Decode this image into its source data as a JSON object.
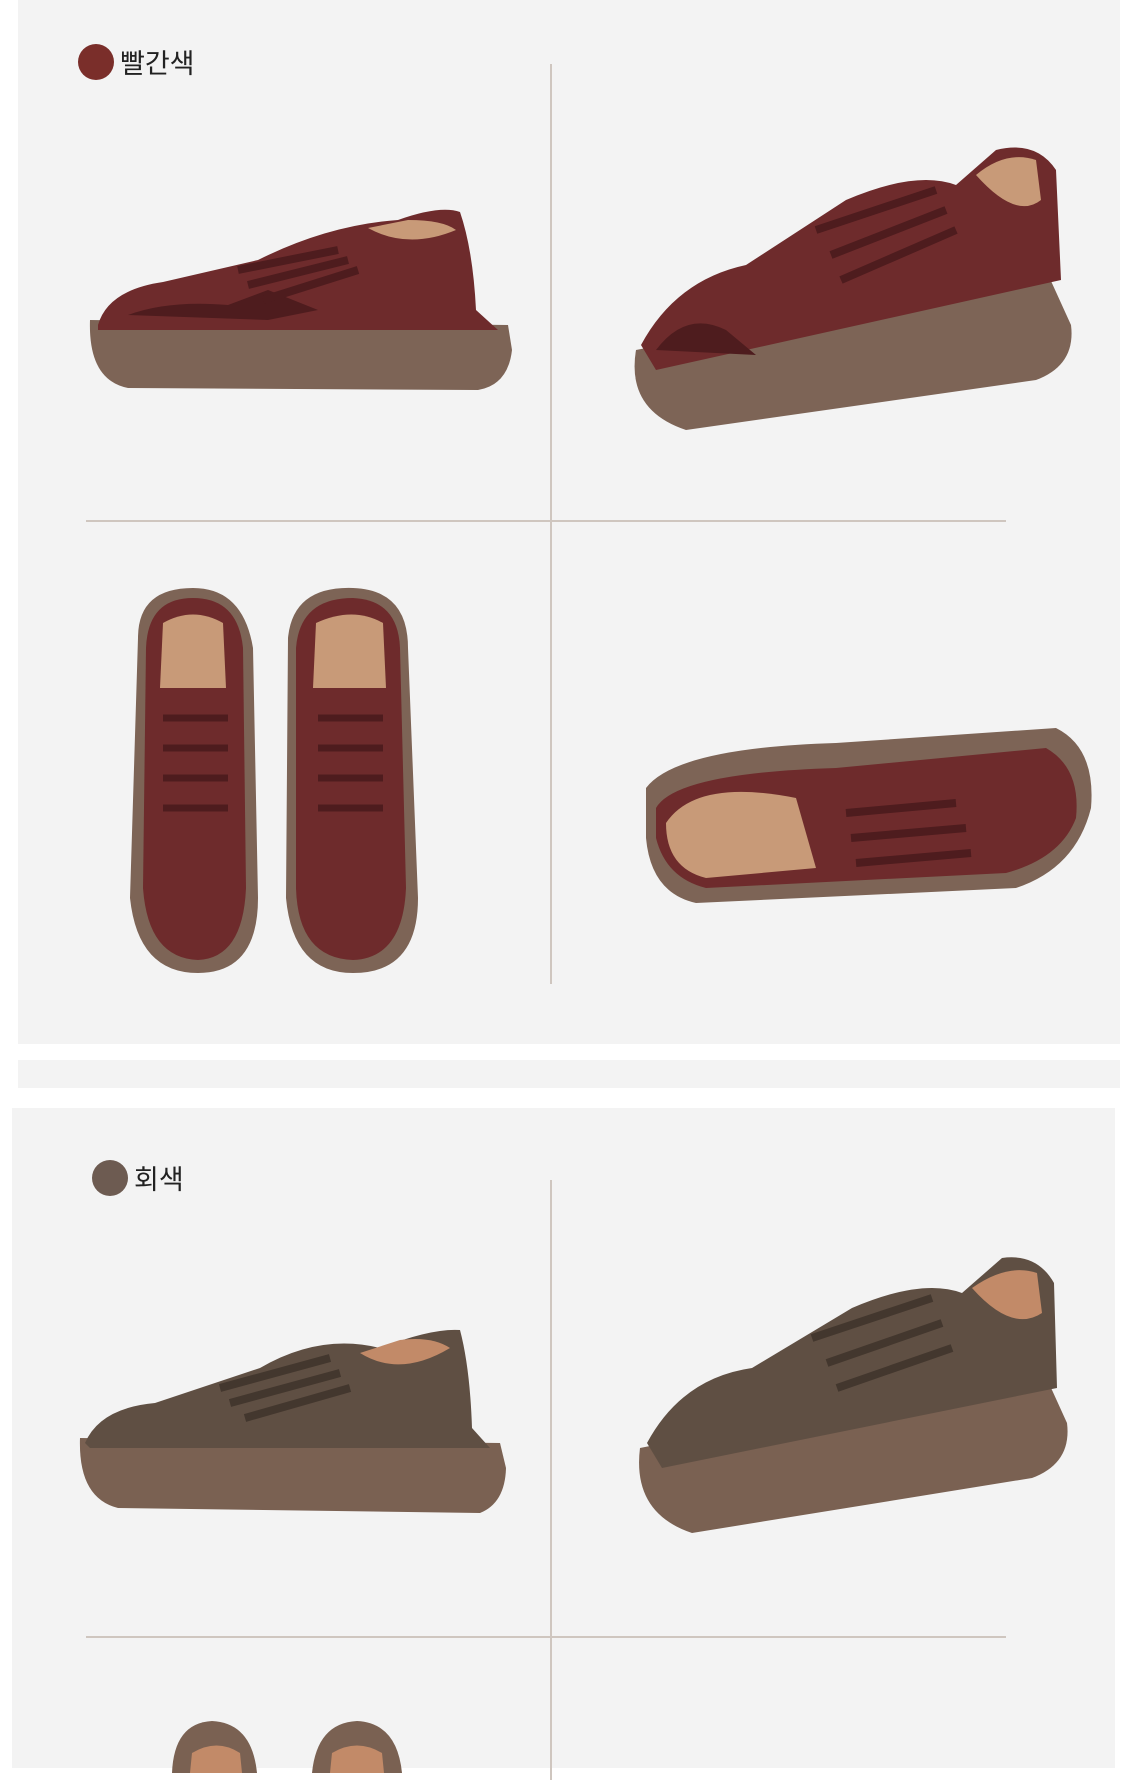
{
  "sections": [
    {
      "color_name": "빨간색",
      "swatch_color": "#7a2e2a",
      "upper_color": "#6e2b2c",
      "upper_dark": "#4e1c1e",
      "sole_color": "#7d6456",
      "lining_color": "#c89a78",
      "views": [
        "side-view",
        "three-quarter-view",
        "top-view",
        "sole-view"
      ]
    },
    {
      "color_name": "회색",
      "swatch_color": "#6d5b51",
      "upper_color": "#5f4f43",
      "upper_dark": "#43372e",
      "sole_color": "#7a6152",
      "lining_color": "#c28a68",
      "views": [
        "side-view",
        "three-quarter-view",
        "top-view"
      ]
    }
  ]
}
